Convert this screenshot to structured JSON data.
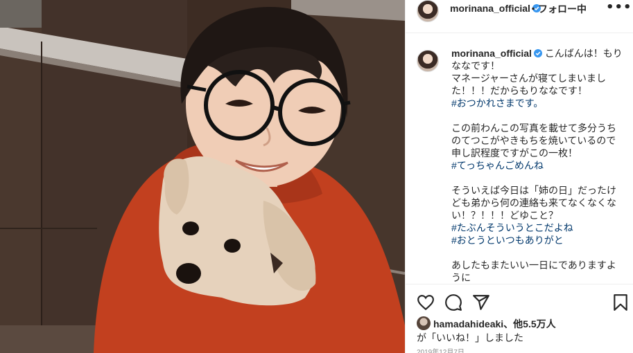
{
  "post": {
    "photo_alt": "",
    "header": {
      "username": "morinana_official",
      "follow_label": "・フォロー中",
      "more_label": "•••"
    },
    "caption": {
      "username": "morinana_official",
      "lines": [
        {
          "text": "こんばんは！もりななです！\nマネージャーさんが寝てしまいました！！！だからもりななです！\n",
          "type": "text"
        },
        {
          "text": "#おつかれさまです。",
          "type": "hashtag"
        },
        {
          "text": "\n\nこの前わんこの写真を載せて多分うちのてつこがやきもちを焼いているので申し訳程度ですがこの一枚！\n",
          "type": "text"
        },
        {
          "text": "#てっちゃんごめんね",
          "type": "hashtag"
        },
        {
          "text": "\n\nそういえば今日は「姉の日」だったけども弟から何の連絡も来てなくなくない！？！！！どゆこと？\n",
          "type": "text"
        },
        {
          "text": "#たぶんそういうとこだよね",
          "type": "hashtag"
        },
        {
          "text": "\n",
          "type": "text"
        },
        {
          "text": "#おとうといつもありがと",
          "type": "hashtag"
        },
        {
          "text": "\n\nあしたもまたいい一日にでありますように",
          "type": "text"
        }
      ]
    },
    "likes": {
      "liker": "hamadahideaki",
      "count_text": "、他5.5万人",
      "suffix": "が「いいね！」しました"
    },
    "date": "2019年12月7日",
    "icons": [
      "like-heart-icon",
      "comment-bubble-icon",
      "share-paper-plane-icon",
      "save-bookmark-icon",
      "verified-badge-icon"
    ],
    "colors": {
      "hashtag": "#00376b",
      "verified": "#3897f0",
      "sweater": "#c2401f"
    }
  }
}
